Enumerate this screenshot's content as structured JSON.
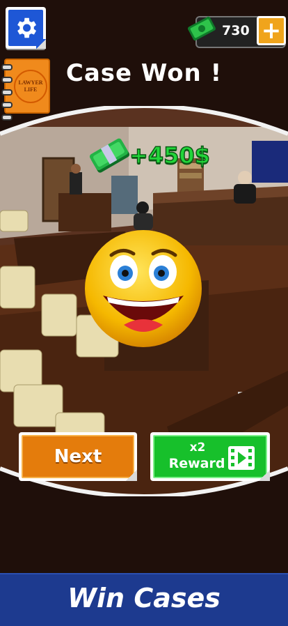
{
  "hud": {
    "money": "730",
    "plus_symbol": "+"
  },
  "notebook": {
    "logo_text_1": "LAWYER",
    "logo_text_2": "LIFE"
  },
  "result": {
    "title": "Case Won !",
    "reward": "+450$"
  },
  "buttons": {
    "next_label": "Next",
    "reward_multiplier": "x2",
    "reward_label": "Reward"
  },
  "banner": {
    "text": "Win Cases"
  },
  "colors": {
    "settings_blue": "#1e57d6",
    "next_orange": "#e47c0c",
    "reward_green": "#17c02b",
    "banner_blue": "#1d3a8f",
    "money_green": "#22d63a"
  },
  "icons": [
    "gear-icon",
    "notebook-icon",
    "cash-icon",
    "plus-icon",
    "emoji-icon",
    "video-icon"
  ]
}
